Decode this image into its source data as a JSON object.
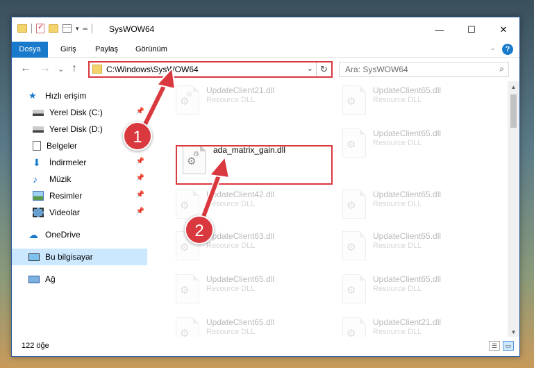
{
  "window": {
    "title": "SysWOW64",
    "buttons": {
      "minimize": "—",
      "maximize": "☐",
      "close": "✕"
    }
  },
  "ribbon": {
    "tabs": [
      "Dosya",
      "Giriş",
      "Paylaş",
      "Görünüm"
    ],
    "help": "?",
    "expand": "⌄"
  },
  "nav": {
    "back": "←",
    "forward": "→",
    "recent": "⌄",
    "up": "↑",
    "address": "C:\\Windows\\SysWOW64",
    "address_dropdown": "⌄",
    "refresh": "↻",
    "search_placeholder": "Ara: SysWOW64",
    "search_icon": "⌕"
  },
  "sidebar": {
    "items": [
      {
        "label": "Hızlı erişim",
        "icon": "star-icon",
        "pinned": false
      },
      {
        "label": "Yerel Disk (C:)",
        "icon": "drive-icon",
        "pinned": true
      },
      {
        "label": "Yerel Disk (D:)",
        "icon": "drive-icon",
        "pinned": false
      },
      {
        "label": "Belgeler",
        "icon": "documents-icon",
        "pinned": true
      },
      {
        "label": "İndirmeler",
        "icon": "download-icon",
        "pinned": true
      },
      {
        "label": "Müzik",
        "icon": "music-icon",
        "pinned": true
      },
      {
        "label": "Resimler",
        "icon": "pictures-icon",
        "pinned": true
      },
      {
        "label": "Videolar",
        "icon": "videos-icon",
        "pinned": true
      },
      {
        "label": "OneDrive",
        "icon": "cloud-icon",
        "pinned": false
      },
      {
        "label": "Bu bilgisayar",
        "icon": "computer-icon",
        "pinned": false,
        "selected": true
      },
      {
        "label": "Ağ",
        "icon": "network-icon",
        "pinned": false
      }
    ],
    "pin_glyph": "📌"
  },
  "files": {
    "col1": [
      {
        "name": "UpdateClient21.dll",
        "type": "Resource DLL"
      },
      {
        "name": "ada_matrix_gain.dll",
        "type": "",
        "highlighted": true
      },
      {
        "name": "UpdateClient42.dll",
        "type": "Resource DLL"
      },
      {
        "name": "UpdateClient63.dll",
        "type": "Resource DLL"
      },
      {
        "name": "UpdateClient65.dll",
        "type": "Resource DLL"
      },
      {
        "name": "UpdateClient65.dll",
        "type": "Resource DLL"
      }
    ],
    "col2": [
      {
        "name": "UpdateClient65.dll",
        "type": "Resource DLL"
      },
      {
        "name": "UpdateClient65.dll",
        "type": "Resource DLL"
      },
      {
        "name": "UpdateClient65.dll",
        "type": "Resource DLL"
      },
      {
        "name": "UpdateClient65.dll",
        "type": "Resource DLL"
      },
      {
        "name": "UpdateClient65.dll",
        "type": "Resource DLL"
      },
      {
        "name": "UpdateClient21.dll",
        "type": "Resource DLL"
      }
    ]
  },
  "status": {
    "item_count": "122 öğe"
  },
  "callouts": {
    "step1": "1",
    "step2": "2"
  },
  "colors": {
    "accent": "#1979ca",
    "highlight": "#d9383e",
    "selected_bg": "#cce8ff"
  }
}
